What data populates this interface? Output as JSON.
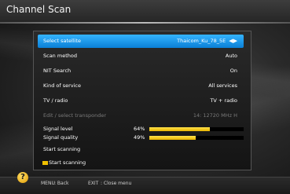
{
  "window": {
    "title": "Channel Scan"
  },
  "menu": [
    {
      "label": "Select satellite",
      "value": "Thaicom_Ku_78_5E",
      "selected": true
    },
    {
      "label": "Scan method",
      "value": "Auto"
    },
    {
      "label": "NIT Search",
      "value": "On"
    },
    {
      "label": "Kind of service",
      "value": "All services"
    },
    {
      "label": "TV / radio",
      "value": "TV + radio"
    },
    {
      "label": "Edit / select transponder",
      "value": "14: 12720 MHz H",
      "disabled": true
    }
  ],
  "signal": {
    "level_label": "Signal level",
    "level_pct": "64%",
    "level": 0.64,
    "quality_label": "Signal quality",
    "quality_pct": "49%",
    "quality": 0.49
  },
  "actions": {
    "start1": "Start scanning",
    "start2": "Start scanning"
  },
  "footer": {
    "menu_key": "MENU",
    "menu_action": ": Back",
    "exit_key": "EXIT",
    "exit_action": ": Close menu"
  },
  "colors": {
    "highlight": "#1a9cf0",
    "bar": "#f0c800"
  }
}
